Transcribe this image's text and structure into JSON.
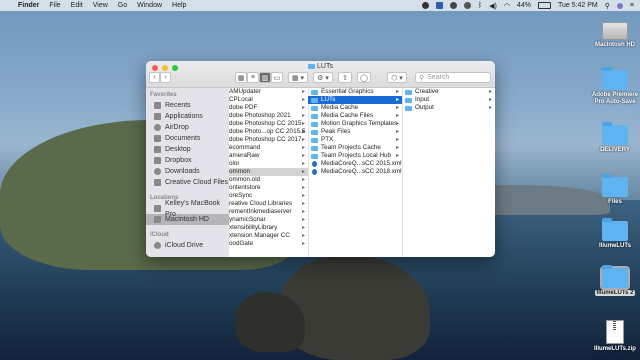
{
  "menubar": {
    "apple": "",
    "items": [
      "Finder",
      "File",
      "Edit",
      "View",
      "Go",
      "Window",
      "Help"
    ],
    "battery": "44%",
    "clock": "Tue 5:42 PM"
  },
  "desktop": {
    "icons": [
      {
        "label": "Macintosh HD",
        "type": "hd"
      },
      {
        "label": "Adobe Premiere Pro Auto-Save",
        "type": "folder"
      },
      {
        "label": "DELIVERY",
        "type": "folder"
      },
      {
        "label": "Files",
        "type": "folder"
      },
      {
        "label": "IllumeLUTs",
        "type": "folder"
      },
      {
        "label": "IllumeLUTs 2",
        "type": "folder"
      },
      {
        "label": "IllumeLUTs.zip",
        "type": "zip"
      }
    ]
  },
  "window": {
    "title": "LUTs",
    "search_placeholder": "Search",
    "sidebar": {
      "favorites_heading": "Favorites",
      "favorites": [
        "Recents",
        "Applications",
        "AirDrop",
        "Documents",
        "Desktop",
        "Dropbox",
        "Downloads",
        "Creative Cloud Files"
      ],
      "locations_heading": "Locations",
      "locations": [
        "Kelley's MacBook Pro",
        "Macintosh HD"
      ],
      "icloud_heading": "iCloud",
      "icloud": [
        "iCloud Drive"
      ]
    },
    "col1": [
      "AMUpdater",
      "CPLocal",
      "dobe PDF",
      "dobe Photoshop 2021",
      "dobe Photoshop CC 2015",
      "dobe Photo...op CC 2015.5",
      "dobe Photoshop CC 2017",
      "ecommand",
      "ameraRaw",
      "olor",
      "ommon",
      "ommon.old",
      "ontentstore",
      "oreSync",
      "reative Cloud Libraries",
      "rementInkmediaserver",
      "ynamicSonar",
      "xtensibilityLibrary",
      "xtension Manager CC",
      "oodGate"
    ],
    "col2": [
      "Essential Graphics",
      "LUTs",
      "Media Cache",
      "Media Cache Files",
      "Motion Graphics Templates",
      "Peak Files",
      "PTX",
      "Team Projects Cache",
      "Team Projects Local Hub",
      "MediaCoreQ...sCC 2015.xml",
      "MediaCoreQ...sCC 2018.xml"
    ],
    "col3": [
      "Creative",
      "Input",
      "Output"
    ]
  }
}
